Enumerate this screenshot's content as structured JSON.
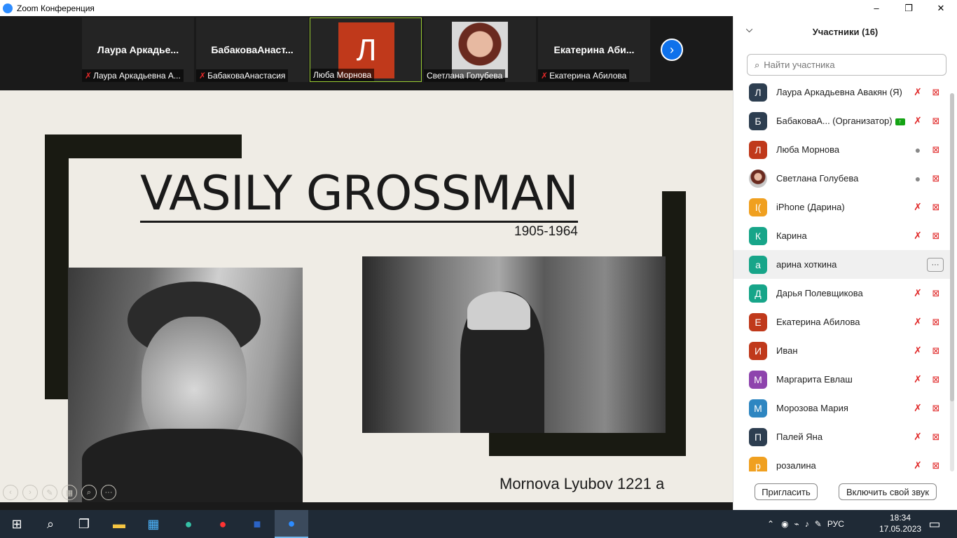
{
  "window": {
    "title": "Zoom Конференция",
    "min": "–",
    "max": "❐",
    "close": "✕"
  },
  "videostrip": {
    "tiles": [
      {
        "name": "Лаура  Аркадье...",
        "label": "Лаура Аркадьевна А...",
        "muted": true
      },
      {
        "name": "БабаковаАнаст...",
        "label": "БабаковаАнастасия",
        "muted": true
      },
      {
        "avatar_letter": "Л",
        "label": "Люба Морнова",
        "muted": false
      },
      {
        "label": "Светлана Голубева",
        "muted": false
      },
      {
        "name": "Екатерина  Аби...",
        "label": "Екатерина Абилова",
        "muted": true
      }
    ],
    "next_icon": "›"
  },
  "slide": {
    "title": "VASILY GROSSMAN",
    "years": "1905-1964",
    "author": "Mornova Lyubov 1221 a"
  },
  "panel": {
    "title": "Участники (16)",
    "search_placeholder": "Найти участника",
    "participants": [
      {
        "initial": "Л",
        "name": "Лаура Аркадьевна Авакян (Я)",
        "color": "#2d3e50",
        "mic": "muted"
      },
      {
        "initial": "Б",
        "name": "БабаковаА...  (Организатор)",
        "color": "#2d3e50",
        "mic": "muted",
        "host": true
      },
      {
        "initial": "Л",
        "name": "Люба Морнова",
        "color": "#c0391b",
        "mic": "on"
      },
      {
        "initial": "",
        "name": "Светлана Голубева",
        "color": "#7a4a3a",
        "mic": "on",
        "photo": true
      },
      {
        "initial": "I(",
        "name": "iPhone (Дарина)",
        "color": "#f0a020",
        "mic": "muted"
      },
      {
        "initial": "К",
        "name": "Карина",
        "color": "#17a589",
        "mic": "muted"
      },
      {
        "initial": "а",
        "name": "арина хоткина",
        "color": "#17a589",
        "mic": "none",
        "hover": true
      },
      {
        "initial": "Д",
        "name": "Дарья Полевщикова",
        "color": "#17a589",
        "mic": "muted"
      },
      {
        "initial": "Е",
        "name": "Екатерина Абилова",
        "color": "#c0391b",
        "mic": "muted"
      },
      {
        "initial": "И",
        "name": "Иван",
        "color": "#c0391b",
        "mic": "muted"
      },
      {
        "initial": "М",
        "name": "Маргарита Евлаш",
        "color": "#8e44ad",
        "mic": "muted"
      },
      {
        "initial": "М",
        "name": "Морозова Мария",
        "color": "#2e86c1",
        "mic": "muted"
      },
      {
        "initial": "П",
        "name": "Палей Яна",
        "color": "#2d3e50",
        "mic": "muted"
      },
      {
        "initial": "р",
        "name": "розалина",
        "color": "#f0a020",
        "mic": "muted"
      }
    ],
    "invite_label": "Пригласить",
    "unmute_label": "Включить свой звук"
  },
  "taskbar": {
    "lang": "РУС",
    "time": "18:34",
    "date": "17.05.2023"
  }
}
